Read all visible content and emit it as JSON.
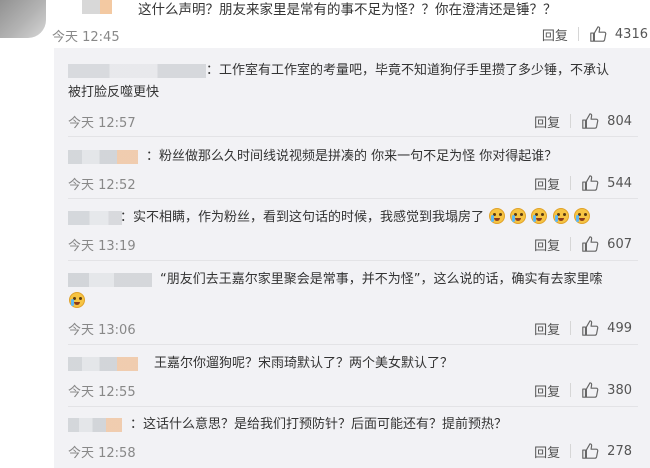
{
  "top_comment": {
    "text": "这什么声明？朋友来家里是常有的事不足为怪？？你在澄清还是锤？？",
    "time": "今天 12:45",
    "reply_label": "回复",
    "likes": "4316"
  },
  "replies": [
    {
      "text_line1": "：工作室有工作室的考量吧，毕竟不知道狗仔手里攒了多少锤，不承认",
      "text_line2": "被打脸反噬更快",
      "time": "今天 12:57",
      "reply_label": "回复",
      "likes": "804"
    },
    {
      "text_line1": "：粉丝做那么久时间线说视频是拼凑的 你来一句不足为怪 你对得起谁？",
      "time": "今天 12:52",
      "reply_label": "回复",
      "likes": "544"
    },
    {
      "text_line1": "：实不相瞒，作为粉丝，看到这句话的时候，我感觉到我塌房了",
      "emojis": [
        "crying-emoji",
        "crying-emoji",
        "crying-emoji",
        "crying-emoji",
        "crying-emoji"
      ],
      "time": "今天 13:19",
      "reply_label": "回复",
      "likes": "607"
    },
    {
      "text_line1": "“朋友们去王嘉尔家里聚会是常事，并不为怪”，这么说的话，确实有去家里嗦",
      "emojis": [
        "laughing-crying-emoji"
      ],
      "time": "今天 13:06",
      "reply_label": "回复",
      "likes": "499"
    },
    {
      "text_line1": "王嘉尔你遛狗呢？宋雨琦默认了？两个美女默认了？",
      "time": "今天 12:55",
      "reply_label": "回复",
      "likes": "380"
    },
    {
      "text_line1": "：这话什么意思？是给我们打预防针？后面可能还有？提前预热？",
      "time": "今天 12:58",
      "reply_label": "回复",
      "likes": "278"
    }
  ],
  "icons": {
    "like": "thumbs-up-icon"
  },
  "colors": {
    "reply_bg": "#f2f2f5",
    "meta_text": "#888888",
    "text": "#333333"
  }
}
